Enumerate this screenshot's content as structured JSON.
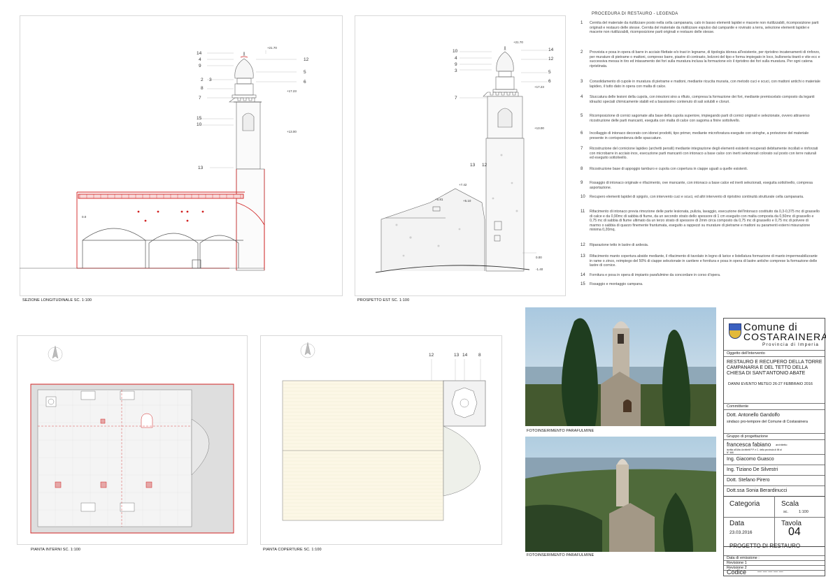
{
  "drawings": {
    "section_caption": "SEZIONE LONGITUDINALE SC. 1:100",
    "east_caption": "PROSPETTO EST SC. 1:100",
    "plan_caption": "PIANTA INTERNI  SC. 1:100",
    "roof_caption": "PIANTA COPERTURE SC. 1:100",
    "photo1_caption": "FOTOINSERIMENTO PARAFULMINE",
    "photo2_caption": "FOTOINSERIMENTO PARAFULMINE",
    "section_callouts_left": [
      "14",
      "4",
      "9",
      "2",
      "8",
      "7",
      "15",
      "10",
      "13"
    ],
    "section_callouts_left_extra": "3",
    "section_callouts_right": [
      "12",
      "5",
      "6"
    ],
    "east_callouts_left": [
      "10",
      "4",
      "9",
      "3",
      "7",
      "13"
    ],
    "east_callouts_right": [
      "14",
      "12",
      "5",
      "6"
    ],
    "east_callout_mid": "12",
    "roof_callouts": [
      "12",
      "13",
      "14",
      "8"
    ],
    "section_levels": [
      "+21.70",
      "+17.23",
      "+13.00",
      "0.0"
    ],
    "east_levels": [
      "+21.70",
      "+17.23",
      "+13.00",
      "+7.42",
      "+5.81",
      "+5.10",
      "0.00",
      "-1.40"
    ]
  },
  "legend": {
    "title": "PROCEDURA DI RESTAURO - LEGENDA",
    "items": [
      {
        "num": "1",
        "text": "Cernita del materiale da riutilizzare posto nella cella campanaria, calo in basso elementi lapidei e macerie non riutilizzabili, ricomposizione parti originali e restauro delle stesse. Cernita del materiale da riutilizzare espulso dal campanile e rovinato a terra, selezione elementi lapidei e macerie non riutilizzabili, ricomposizione parti originali e restauro delle stesse."
      },
      {
        "num": "2",
        "text": "Provvista e posa in opera di barre in acciaio filettate e/o travi in legname, di tipologia idonea all'esistente, per ripristino incatenamenti di rinforzo, per murature di pietrame o mattoni, compreso barre, piastre di contrasto, bolzoni del tipo e forma impiegato in loco, bulloneria tiranti e vite ecc e successiva messa in tiro ed intasamento dei fori sulla muratura inclusa la formazione e/o il ripristino dei fori sulla muratura. Per ogni catena ripristinata."
      },
      {
        "num": "3",
        "text": "Consolidamento di cupole in muratura di pietrame e mattoni, mediante ricucita muraria, con metodo cuci e scuci, con mattoni antichi o materiale lapideo, il tutto dato in opera con malta di calce."
      },
      {
        "num": "4",
        "text": "Stuccatura delle lesioni della cupola, con iniezioni sino a rifiuto, compresa la formazione dei fori, mediante premiscelato composto da leganti idraulici speciali chimicamente stabili ed a bassissimo contenuto di sali solubili e cloruri."
      },
      {
        "num": "5",
        "text": "Ricomposizione di cornici sagomate alla base della cupola superiore, impiegando parti di cornici originali e selezionate, ovvero attraverso ricostruzione delle parti mancanti, eseguita con malta di calce con sagoma a finire sottolivello."
      },
      {
        "num": "6",
        "text": "Incollaggio di intonaco decorato con idonei prodotti, tipo primer, mediante microforatura eseguite con siringhe, a protezione del materiale presente in corrispondenza delle spaccature."
      },
      {
        "num": "7",
        "text": "Ricostruzione del cornicione lapideo (archetti pensili) mediante integrazione degli elementi esistenti recuperati debitamente incollati e rinforzati con microbarre in acciaio inox, esecuzione parti mancanti con intonaco a base calce con inerti selezionati colorato sul posto con terre naturali ed eseguito sottolivello."
      },
      {
        "num": "8",
        "text": "Ricostruzione base di appoggio tamburo e cupola con copertura in ciappe uguali a quelle esistenti."
      },
      {
        "num": "9",
        "text": "Fissaggio di intonaco originale e rifacimento, ove mancante, con intonaco a base calce ed inerti selezionati, eseguita sottolivello, compresa asportazione."
      },
      {
        "num": "10",
        "text": "Recupero elementi lapidei di spigolo, con intervento cuci e scuci, ed altri intervento di ripristino continuità strutturale cella campanaria."
      },
      {
        "num": "11",
        "text": "Rifacimento di intonaco previa rimozione delle parte lesionata, pulizia, lavaggio, esecuzione dell'intonaco costituito da 0,3-0,375 mc di grassello di calce e da 0,90mc di sabbia di fiume, da un secondo strato dello spessore di 1 cm eseguito con malta composta da 0,50mc di grassello e 0,75 mc di sabbia di fiume ultimato da un terzo strato di spessore di 2mm circa composto da 0,75 mc di grassello e 0,75 mc di polvere di marmo o sabbia di quarzo finemente frantumata, eseguito a rappezzi su murature di pietrame e mattoni su paramenti esterni misurazione minima 0,20mq."
      },
      {
        "num": "12",
        "text": "Riparazione tetto in lastre di ardesia."
      },
      {
        "num": "13",
        "text": "Rifacimento manto copertura abside mediante, il rifacimento di tavolato in legno di larice e listellatura formazione di manto impermeabilizzante in rame o zinco, reimpiego del 50% di ciappe selezionate in cantiere e fornitura e posa in opera di lastre antiche comprese la formazione delle lastre di cornice."
      },
      {
        "num": "14",
        "text": "Fornitura e posa in opera di impianto parafulmine da concordare in corso d'opera."
      },
      {
        "num": "15",
        "text": "Fissaggio e montaggio campana."
      }
    ]
  },
  "titleblock": {
    "comune_line1": "Comune di",
    "comune_line2": "COSTARAINERA",
    "provincia": "Provincia di Imperia",
    "oggetto_label": "Oggetto dell'intervento",
    "oggetto_lines": [
      "RESTAURO E RECUPERO DELLA TORRE",
      "CAMPANARIA E DEL TETTO DELLA",
      "CHIESA DI SANT'ANTONIO ABATE"
    ],
    "evento": "DANNI EVENTO METEO  26-27 FEBBRAIO 2016",
    "committente_label": "Committente",
    "committente_name": "Dott. Antonello Gandolfo",
    "committente_role": "sindaco pro-tempore del Comune di Costarainera",
    "gruppo_label": "Gruppo di progettazione",
    "designer_main": "francesca fabiano",
    "designer_title": "architetto",
    "designer_note": "iscritta all'Albo Architetti P.P. e C. della provincia di IM al N° 466",
    "team": [
      "Ing. Giacomo Guasco",
      "Ing. Tiziano De Silvestri",
      "Dott. Stefano Pirero",
      "Dott.ssa Sonia Berardinucci"
    ],
    "categoria_label": "Categoria",
    "scala_label": "Scala",
    "scala_prefix": "sc.",
    "scala_value": "1:100",
    "data_label": "Data",
    "data_value": "23.03.2016",
    "tavola_label": "Tavola",
    "tavola_value": "04",
    "project_type": "PROGETTO DI RESTAURO",
    "emissione_label": "Data di emissione :",
    "revisione1": "Revisione 1",
    "revisione2": "Revisione 2",
    "codice_label": "Codice",
    "codice_dashes": "—  —  —  —  —"
  },
  "colors": {
    "red_line": "#d02020",
    "grey_line": "#666666",
    "sky": "#9ec2dc",
    "tree": "#1f3d1f"
  }
}
